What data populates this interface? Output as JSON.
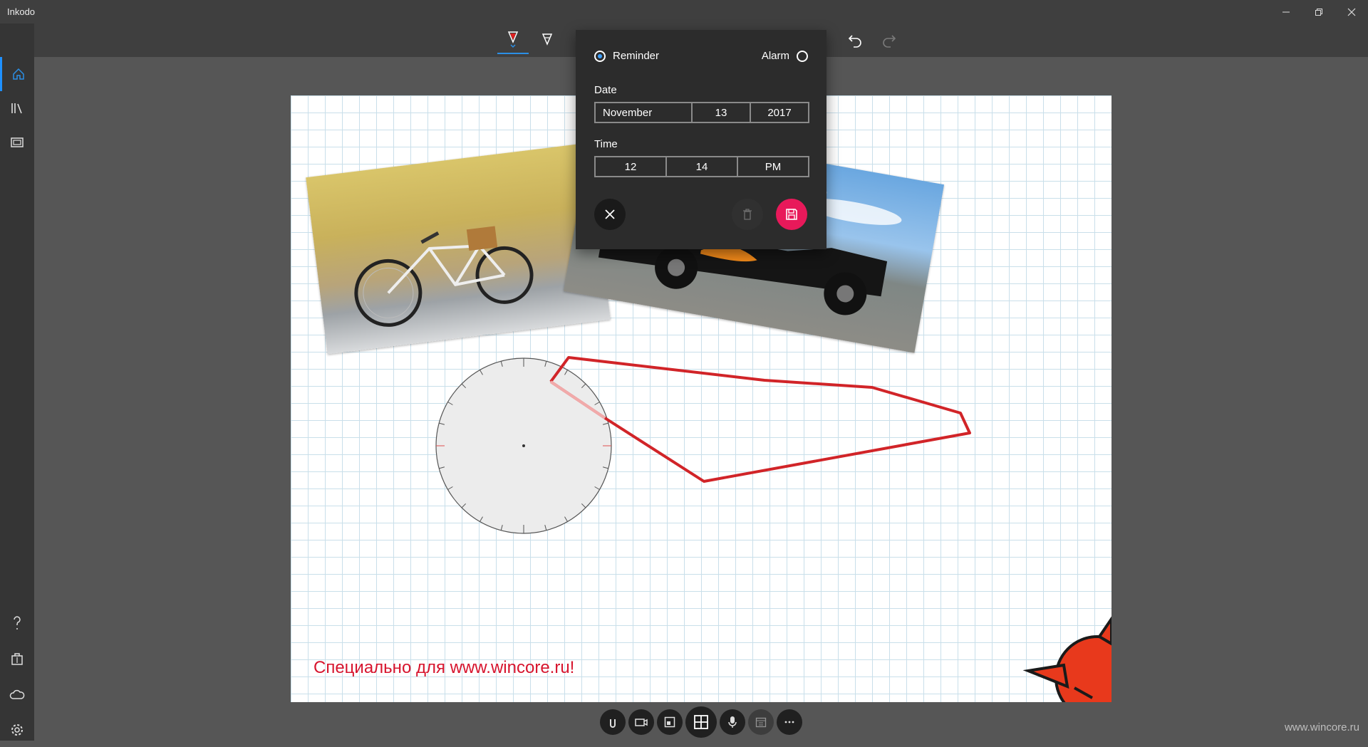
{
  "app": {
    "title": "Inkodo"
  },
  "colors": {
    "accent": "#1e90ff",
    "save": "#e8195a",
    "ink": "#d12428",
    "footer_text": "#d7142d"
  },
  "reminder": {
    "option_reminder": "Reminder",
    "option_alarm": "Alarm",
    "selected": "Reminder",
    "date_label": "Date",
    "date": {
      "month": "November",
      "day": "13",
      "year": "2017"
    },
    "time_label": "Time",
    "time": {
      "hour": "12",
      "minute": "14",
      "ampm": "PM"
    }
  },
  "canvas": {
    "footer_text": "Специально для www.wincore.ru!"
  },
  "watermark": "www.wincore.ru",
  "icons": {
    "sidebar_top": [
      "menu-icon",
      "home-icon",
      "library-icon",
      "slides-icon"
    ],
    "sidebar_bottom": [
      "help-icon",
      "store-icon",
      "cloud-icon",
      "settings-icon"
    ],
    "toolbar": [
      "pen-icon",
      "highlighter-icon",
      "undo-icon",
      "redo-icon"
    ],
    "bottombar": [
      "attach-icon",
      "camera-icon",
      "layout-icon",
      "grid-icon",
      "microphone-icon",
      "calendar-icon",
      "more-icon"
    ]
  }
}
